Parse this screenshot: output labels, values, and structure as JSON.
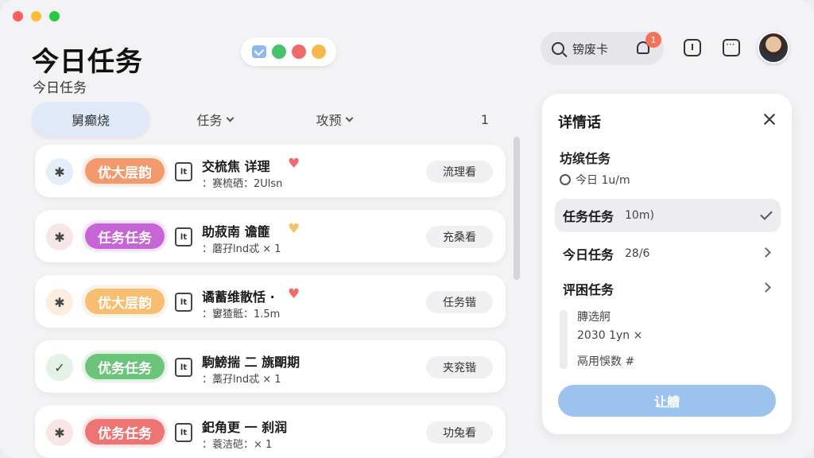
{
  "header": {
    "title": "今日任务",
    "subtitle": "今日任务",
    "search_text": "镑废卡",
    "notification_count": "1"
  },
  "tabs": [
    {
      "label": "舅癫烧"
    },
    {
      "label": "任务"
    },
    {
      "label": "攻预"
    },
    {
      "label": "1"
    }
  ],
  "tasks": [
    {
      "lead": "✱",
      "lead_color": "#e3eef8",
      "tag": "优大层韵",
      "tag_color": "#f29a6b",
      "icon_text": "lt",
      "title": "交梳焦 详理",
      "heart": "♥",
      "heart_color": "#f06b6b",
      "meta": "：赛梳硒：2Ulsn",
      "action": "流理看"
    },
    {
      "lead": "✱",
      "lead_color": "#f7e6e6",
      "tag": "任务任务",
      "tag_color": "#c764d6",
      "icon_text": "lt",
      "title": "助菽南 谵篚",
      "heart": "♥",
      "heart_color": "#f5c46a",
      "meta": "：蘑孖lnd忒 × 1",
      "action": "充桑看"
    },
    {
      "lead": "✱",
      "lead_color": "#fbeede",
      "tag": "优大层韵",
      "tag_color": "#f7bd70",
      "icon_text": "lt",
      "title": "谲蓄维散恬 ·",
      "heart": "♥",
      "heart_color": "#f06b6b",
      "meta": "：窶猹骶：1.5m",
      "action": "任务锴"
    },
    {
      "lead": "✓",
      "lead_color": "#e4f2e6",
      "tag": "优务任务",
      "tag_color": "#6cc47a",
      "icon_text": "lt",
      "title": "駒鰟揣 二 旐朙期",
      "heart": "",
      "heart_color": "#ffffff",
      "meta": "：藁孖lnd忒 × 1",
      "action": "夹兖锴"
    },
    {
      "lead": "✱",
      "lead_color": "#f8e6e3",
      "tag": "优务任务",
      "tag_color": "#ee7474",
      "icon_text": "lt",
      "title": "釲角更 一 刹润",
      "heart": "",
      "heart_color": "#ffffff",
      "meta": "：蓑洁硙：× 1",
      "action": "功兔看"
    }
  ],
  "panel": {
    "title": "详情话",
    "label": "坊缤任务",
    "time": "今日 1u/m",
    "rows": [
      {
        "label": "任务任务",
        "value": "10m)"
      },
      {
        "label": "今日任务",
        "value": "28/6"
      },
      {
        "label": "评困任务",
        "value": ""
      }
    ],
    "notes": [
      "膞选舸",
      "2030 1yn ×",
      "鬲用悞数 #"
    ],
    "submit": "让艚"
  },
  "colors": {
    "accent": "#9cc2ee",
    "active_tab": "#dfe9f8",
    "badge": "#f2735a"
  },
  "icons": {
    "mail": "mail-icon",
    "search": "search-icon",
    "bell": "bell-icon",
    "info": "info-icon",
    "chat": "chat-icon",
    "close": "close-icon",
    "clock": "clock-icon"
  }
}
